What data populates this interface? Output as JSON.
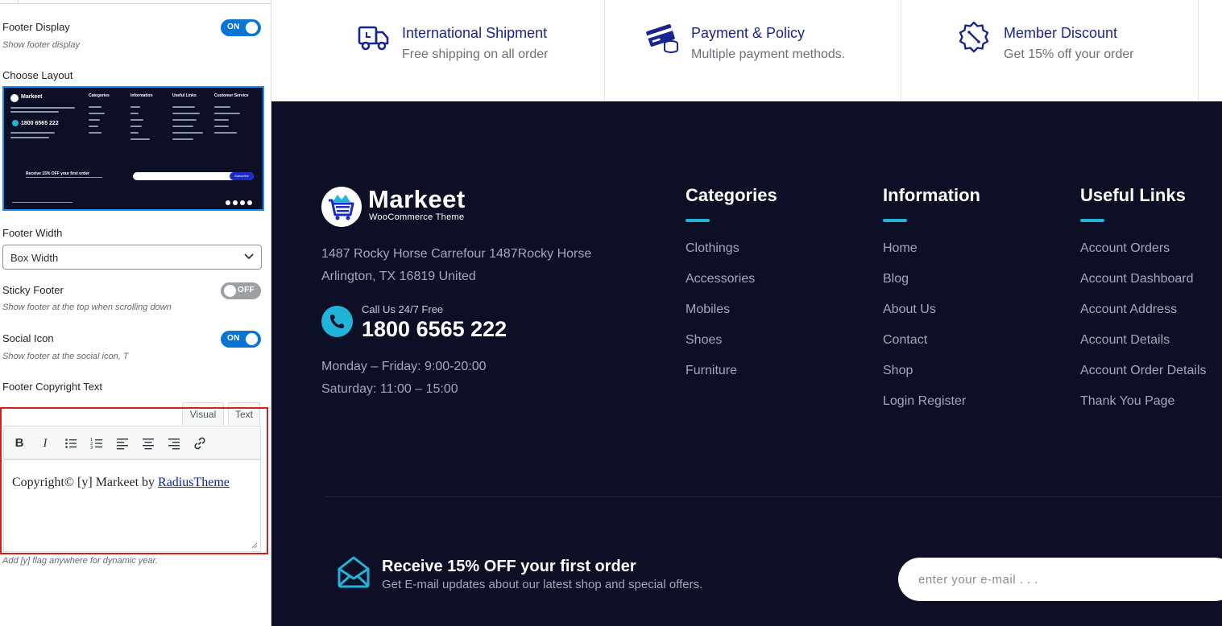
{
  "panel": {
    "footer_display": {
      "label": "Footer Display",
      "desc": "Show footer display",
      "toggle": "ON"
    },
    "choose_layout": {
      "label": "Choose Layout"
    },
    "thumbnail": {
      "logo": "Markeet",
      "phone": "1800 6565 222",
      "headings": [
        "Categories",
        "Information",
        "Useful Links",
        "Customer Service"
      ],
      "subscribe_text": "Receive 15% OFF your first order",
      "subscribe_button": "Subscribe"
    },
    "footer_width": {
      "label": "Footer Width",
      "value": "Box Width"
    },
    "sticky_footer": {
      "label": "Sticky Footer",
      "desc": "Show footer at the top when scrolling down",
      "toggle": "OFF"
    },
    "social_icon": {
      "label": "Social Icon",
      "desc": "Show footer at the social icon, T",
      "toggle": "ON"
    },
    "copyright": {
      "label": "Footer Copyright Text",
      "tab_visual": "Visual",
      "tab_text": "Text",
      "content_prefix": "Copyright© [y] Markeet by ",
      "content_link": "RadiusTheme",
      "hint": "Add [y] flag anywhere for dynamic year."
    }
  },
  "features": [
    {
      "icon": "truck-icon",
      "title": "International Shipment",
      "subtitle": "Free shipping on all order"
    },
    {
      "icon": "credit-card-icon",
      "title": "Payment & Policy",
      "subtitle": "Multiple payment methods."
    },
    {
      "icon": "discount-badge-icon",
      "title": "Member Discount",
      "subtitle": "Get 15% off your order"
    }
  ],
  "footer": {
    "logo_name": "Markeet",
    "logo_tagline": "WooCommerce Theme",
    "address_line1": "1487 Rocky Horse Carrefour 1487Rocky Horse",
    "address_line2": "Arlington, TX 16819 United",
    "call_label": "Call Us 24/7 Free",
    "call_number": "1800 6565 222",
    "hours_line1": "Monday – Friday: 9:00-20:00",
    "hours_line2": "Saturday: 11:00 – 15:00",
    "columns": [
      {
        "heading": "Categories",
        "items": [
          "Clothings",
          "Accessories",
          "Mobiles",
          "Shoes",
          "Furniture"
        ]
      },
      {
        "heading": "Information",
        "items": [
          "Home",
          "Blog",
          "About Us",
          "Contact",
          "Shop",
          "Login Register"
        ]
      },
      {
        "heading": "Useful Links",
        "items": [
          "Account Orders",
          "Account Dashboard",
          "Account Address",
          "Account Details",
          "Account Order Details",
          "Thank You Page"
        ]
      }
    ],
    "newsletter": {
      "title": "Receive 15% OFF your first order",
      "subtitle": "Get E-mail updates about our latest shop and special offers.",
      "placeholder": "enter your e-mail . . ."
    }
  },
  "colors": {
    "toggle_on": "#0a75d1",
    "footer_bg": "#0d0f26",
    "accent": "#1fb4d8",
    "feature_title": "#1a2690"
  }
}
